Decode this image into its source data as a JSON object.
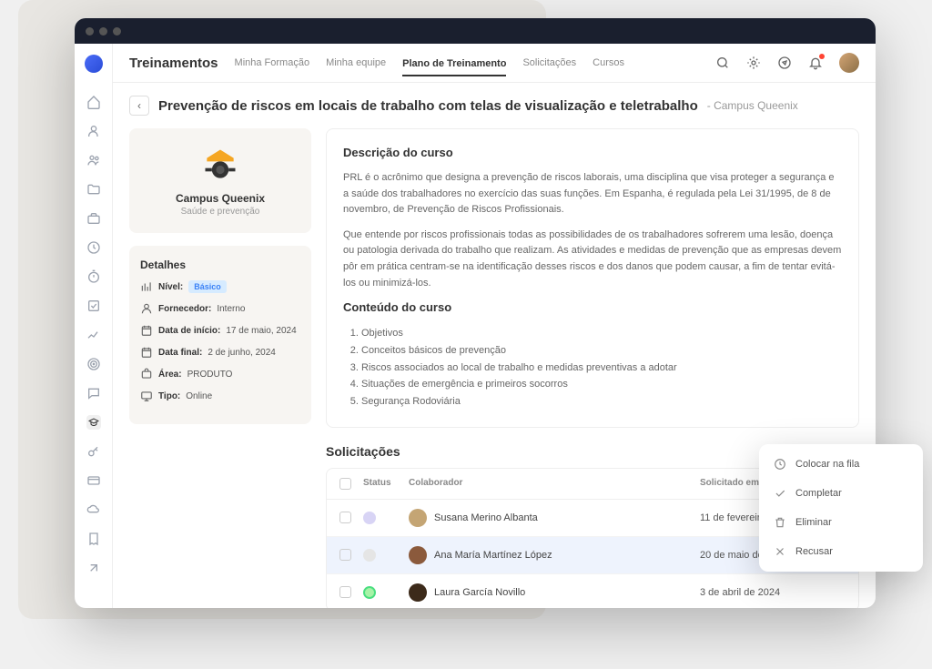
{
  "topbar": {
    "title": "Treinamentos",
    "tabs": [
      {
        "label": "Minha Formação"
      },
      {
        "label": "Minha equipe"
      },
      {
        "label": "Plano de Treinamento"
      },
      {
        "label": "Solicitações"
      },
      {
        "label": "Cursos"
      }
    ]
  },
  "page": {
    "title": "Prevenção de riscos em locais de trabalho com telas de visualização e teletrabalho",
    "suffix": "- Campus Queenix"
  },
  "provider": {
    "name": "Campus Queenix",
    "subtitle": "Saúde e prevenção"
  },
  "details": {
    "heading": "Detalhes",
    "rows": {
      "level_label": "Nível:",
      "level_badge": "Básico",
      "supplier_label": "Fornecedor:",
      "supplier_val": "Interno",
      "start_label": "Data de início:",
      "start_val": "17 de maio, 2024",
      "end_label": "Data final:",
      "end_val": "2 de junho, 2024",
      "area_label": "Área:",
      "area_val": "PRODUTO",
      "type_label": "Tipo:",
      "type_val": "Online"
    }
  },
  "description": {
    "heading": "Descrição do curso",
    "p1": "PRL é o acrônimo que designa a prevenção de riscos laborais, uma disciplina que visa proteger a segurança e a saúde dos trabalhadores no exercício das suas funções. Em Espanha, é regulada pela Lei 31/1995, de 8 de novembro, de Prevenção de Riscos Profissionais.",
    "p2": "Que entende por riscos profissionais todas as possibilidades de os trabalhadores sofrerem uma lesão, doença ou patologia derivada do trabalho que realizam. As atividades e medidas de prevenção que as empresas devem pôr em prática centram-se na identificação desses riscos e dos danos que podem causar, a fim de tentar evitá-los ou minimizá-los.",
    "content_heading": "Conteúdo do curso",
    "items": [
      "Objetivos",
      "Conceitos básicos de prevenção",
      "Riscos associados ao local de trabalho e medidas preventivas a adotar",
      "Situações de emergência e primeiros socorros",
      "Segurança Rodoviária"
    ]
  },
  "requests": {
    "heading": "Solicitações",
    "columns": {
      "status": "Status",
      "collaborator": "Colaborador",
      "requested": "Solicitado em"
    },
    "rows": [
      {
        "name": "Susana Merino Albanta",
        "date": "11 de fevereiro de"
      },
      {
        "name": "Ana María Martínez López",
        "date": "20 de maio de 20"
      },
      {
        "name": "Laura García Novillo",
        "date": "3 de abril de 2024"
      }
    ]
  },
  "context_menu": {
    "queue": "Colocar na fila",
    "complete": "Completar",
    "delete": "Eliminar",
    "refuse": "Recusar"
  }
}
